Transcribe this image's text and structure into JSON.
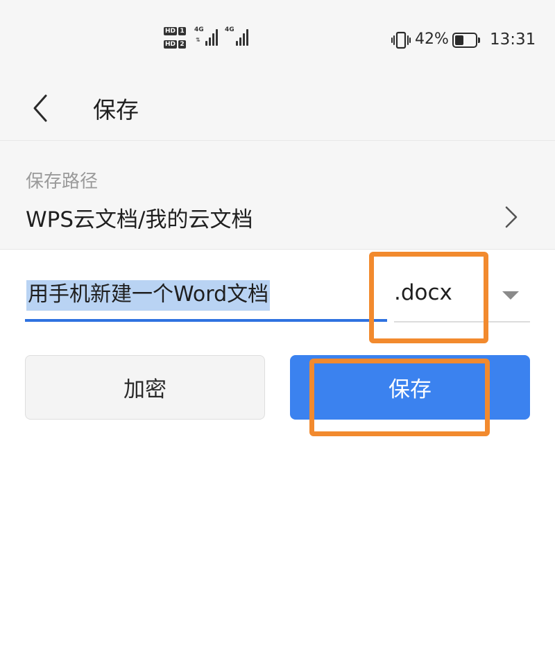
{
  "status_bar": {
    "sim1_label": "HD",
    "sim1_number": "1",
    "sim2_label": "HD",
    "sim2_number": "2",
    "network_1": "4G",
    "network_2": "4G",
    "battery_percent": "42%",
    "battery_level": 0.42,
    "time": "13:31"
  },
  "nav": {
    "title": "保存",
    "back_icon": "chevron-left-icon"
  },
  "save_path": {
    "label": "保存路径",
    "value": "WPS云文档/我的云文档",
    "chevron_icon": "chevron-right-icon"
  },
  "file": {
    "name": "用手机新建一个Word文档",
    "extension": ".docx",
    "dropdown_icon": "caret-down-icon"
  },
  "buttons": {
    "encrypt_label": "加密",
    "save_label": "保存"
  },
  "colors": {
    "primary": "#3b82ef",
    "selection": "#b9d3f3",
    "highlight": "#f28a2e"
  }
}
